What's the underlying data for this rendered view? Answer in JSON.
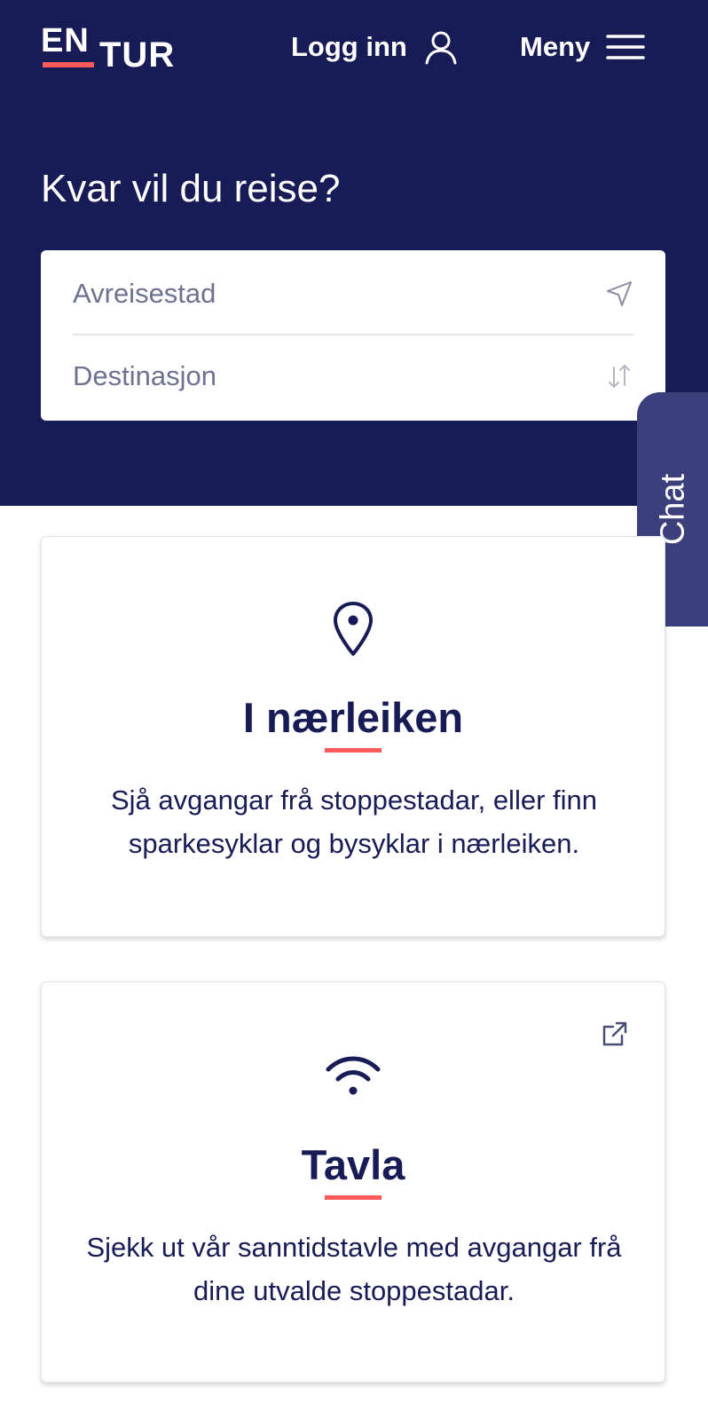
{
  "header": {
    "logo_top": "EN",
    "logo_bottom": "TUR",
    "login_label": "Logg inn",
    "menu_label": "Meny"
  },
  "search": {
    "headline": "Kvar vil du reise?",
    "from_placeholder": "Avreisestad",
    "to_placeholder": "Destinasjon"
  },
  "chat": {
    "label": "Chat"
  },
  "cards": [
    {
      "icon": "map-pin-icon",
      "title": "I nærleiken",
      "description": "Sjå avgangar frå stoppestadar, eller finn sparkesyklar og bysyklar i nærleiken."
    },
    {
      "icon": "wifi-icon",
      "title": "Tavla",
      "description": "Sjekk ut vår sanntidstavle med avgangar frå dine utvalde stoppestadar.",
      "external_link_icon": "external-link-icon"
    }
  ],
  "colors": {
    "navy": "#181c56",
    "accent_red": "#ff5959",
    "chat_tab": "#3b3f7c",
    "placeholder": "#6e7191"
  }
}
